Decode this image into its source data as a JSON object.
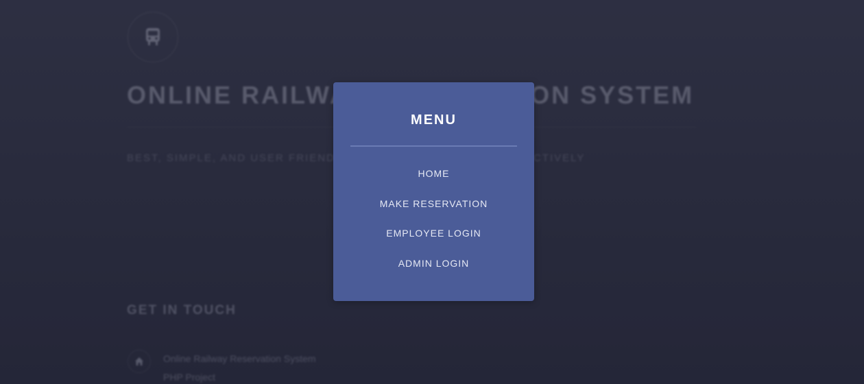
{
  "page": {
    "title": "ONLINE RAILWAY RESERVATION SYSTEM",
    "tagline": "BEST, SIMPLE, AND USER FRIENDLY WAY TO BOOK TICKETS EFFECTIVELY",
    "logo_icon": "train-icon"
  },
  "contact": {
    "heading": "GET IN TOUCH",
    "icon": "home-icon",
    "line1": "Online Railway Reservation System",
    "line2": "PHP Project"
  },
  "menu": {
    "title": "MENU",
    "items": [
      {
        "label": "HOME"
      },
      {
        "label": "MAKE RESERVATION"
      },
      {
        "label": "EMPLOYEE LOGIN"
      },
      {
        "label": "ADMIN LOGIN"
      }
    ]
  },
  "colors": {
    "menu_background": "#4b5c98",
    "page_background": "#2c2f42",
    "menu_text": "#ffffff"
  }
}
